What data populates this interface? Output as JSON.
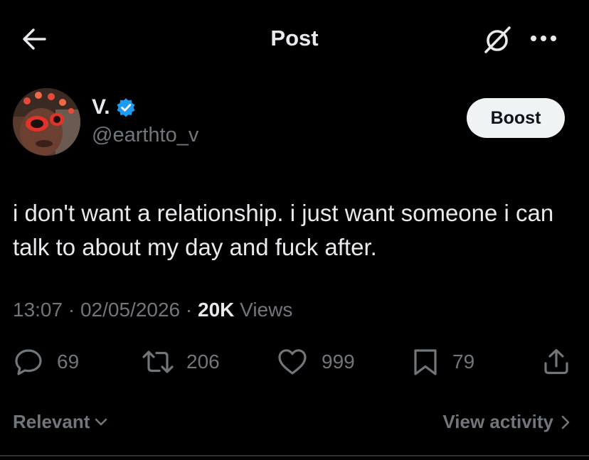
{
  "header": {
    "title": "Post",
    "back_icon": "arrow-left-icon",
    "grok_icon": "grok-icon",
    "more_icon": "more-horizontal-icon"
  },
  "author": {
    "display_name": "V.",
    "handle": "@earthto_v",
    "verified": true,
    "verified_color": "#1d9bf0"
  },
  "boost_label": "Boost",
  "tweet": {
    "text": "i don't want a relationship. i just want someone i can talk to about my day and fuck after."
  },
  "meta": {
    "time": "13:07",
    "separator": "·",
    "date": "02/05/2026",
    "views_count": "20K",
    "views_label": "Views"
  },
  "actions": {
    "replies": "69",
    "reposts": "206",
    "likes": "999",
    "bookmarks": "79"
  },
  "footer": {
    "sort_label": "Relevant",
    "view_activity_label": "View activity"
  },
  "colors": {
    "background": "#000000",
    "primary_text": "#e7e9ea",
    "secondary_text": "#71767b",
    "boost_bg": "#eff3f4"
  }
}
